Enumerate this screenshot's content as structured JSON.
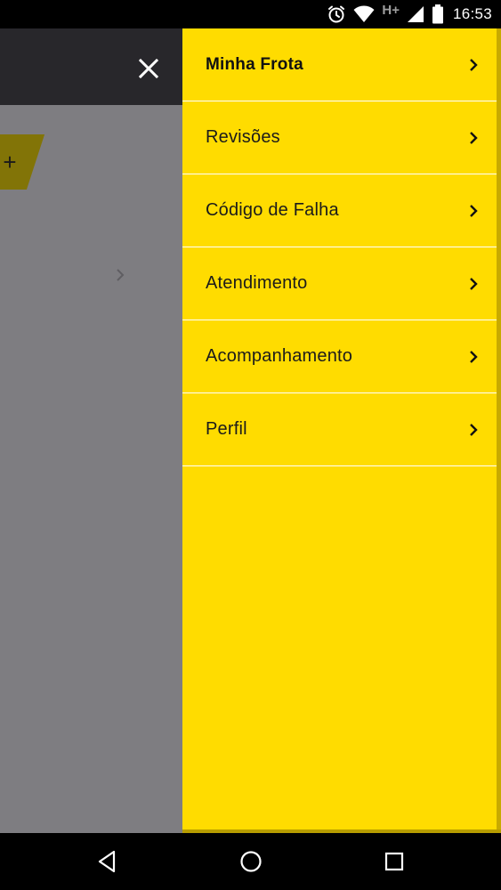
{
  "status_bar": {
    "network_label": "H+",
    "time": "16:53",
    "icons": [
      "alarm-icon",
      "wifi-icon",
      "signal-icon",
      "battery-icon"
    ]
  },
  "header": {
    "close_icon": "close-icon"
  },
  "background": {
    "add_label": "+"
  },
  "drawer": {
    "items": [
      {
        "label": "Minha Frota",
        "active": true
      },
      {
        "label": "Revisões",
        "active": false
      },
      {
        "label": "Código de Falha",
        "active": false
      },
      {
        "label": "Atendimento",
        "active": false
      },
      {
        "label": "Acompanhamento",
        "active": false
      },
      {
        "label": "Perfil",
        "active": false
      }
    ]
  },
  "nav_bar": {
    "icons": [
      "back-icon",
      "home-icon",
      "recents-icon"
    ]
  },
  "colors": {
    "drawer_bg": "#ffdc00",
    "header_bg": "#28272b",
    "scrim": "#7e7d81",
    "add_tab": "#827407"
  }
}
